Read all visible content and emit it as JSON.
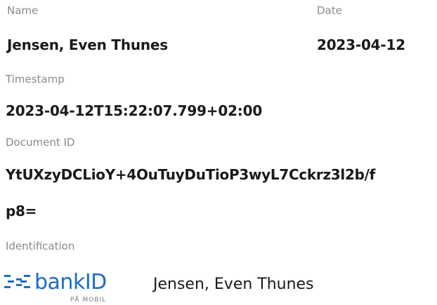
{
  "name": {
    "label": "Name",
    "value": "Jensen, Even Thunes"
  },
  "date": {
    "label": "Date",
    "value": "2023-04-12"
  },
  "timestamp": {
    "label": "Timestamp",
    "value": "2023-04-12T15:22:07.799+02:00"
  },
  "document_id": {
    "label": "Document ID",
    "line1": "YtUXzyDCLioY+4OuTuyDuTioP3wyL7Cckrz3l2b/f",
    "line2": "p8="
  },
  "identification": {
    "label": "Identification",
    "logo_text": "bankID",
    "logo_subtext": "PÅ MOBIL",
    "logo_icon": "bankid-logo-icon",
    "logo_color": "#1a6ec9",
    "name": "Jensen, Even Thunes"
  }
}
